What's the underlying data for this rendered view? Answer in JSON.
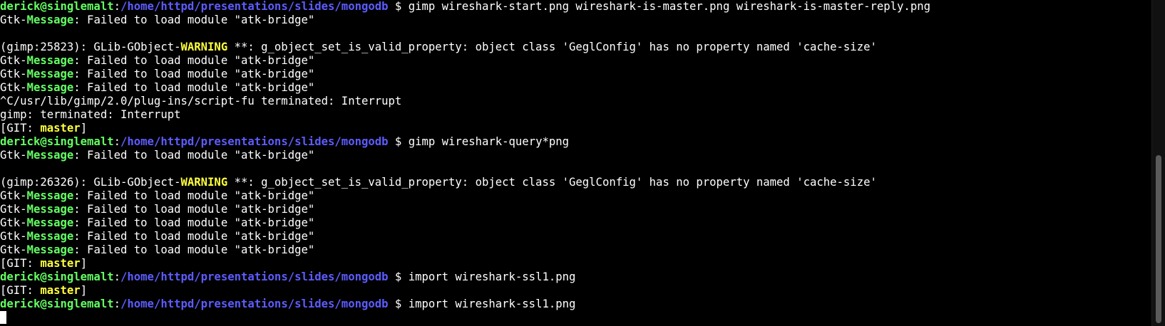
{
  "lines": [
    [
      {
        "t": "derick@singlemalt",
        "c": "green"
      },
      {
        "t": ":",
        "c": "white"
      },
      {
        "t": "/home/httpd/presentations/slides/mongodb",
        "c": "blue"
      },
      {
        "t": " $ gimp wireshark-start.png wireshark-is-master.png wireshark-is-master-reply.png",
        "c": "white"
      }
    ],
    [
      {
        "t": "Gtk-",
        "c": "white"
      },
      {
        "t": "Message",
        "c": "green"
      },
      {
        "t": ": Failed to load module \"atk-bridge\"",
        "c": "white"
      }
    ],
    [],
    [
      {
        "t": "(gimp:25823): GLib-GObject-",
        "c": "white"
      },
      {
        "t": "WARNING",
        "c": "yellow"
      },
      {
        "t": " **: g_object_set_is_valid_property: object class 'GeglConfig' has no property named 'cache-size'",
        "c": "white"
      }
    ],
    [
      {
        "t": "Gtk-",
        "c": "white"
      },
      {
        "t": "Message",
        "c": "green"
      },
      {
        "t": ": Failed to load module \"atk-bridge\"",
        "c": "white"
      }
    ],
    [
      {
        "t": "Gtk-",
        "c": "white"
      },
      {
        "t": "Message",
        "c": "green"
      },
      {
        "t": ": Failed to load module \"atk-bridge\"",
        "c": "white"
      }
    ],
    [
      {
        "t": "Gtk-",
        "c": "white"
      },
      {
        "t": "Message",
        "c": "green"
      },
      {
        "t": ": Failed to load module \"atk-bridge\"",
        "c": "white"
      }
    ],
    [
      {
        "t": "^C/usr/lib/gimp/2.0/plug-ins/script-fu terminated: Interrupt",
        "c": "white"
      }
    ],
    [
      {
        "t": "gimp: terminated: Interrupt",
        "c": "white"
      }
    ],
    [
      {
        "t": "[GIT: ",
        "c": "white"
      },
      {
        "t": "master",
        "c": "yellow"
      },
      {
        "t": "]",
        "c": "white"
      }
    ],
    [
      {
        "t": "derick@singlemalt",
        "c": "green"
      },
      {
        "t": ":",
        "c": "white"
      },
      {
        "t": "/home/httpd/presentations/slides/mongodb",
        "c": "blue"
      },
      {
        "t": " $ gimp wireshark-query*png",
        "c": "white"
      }
    ],
    [
      {
        "t": "Gtk-",
        "c": "white"
      },
      {
        "t": "Message",
        "c": "green"
      },
      {
        "t": ": Failed to load module \"atk-bridge\"",
        "c": "white"
      }
    ],
    [],
    [
      {
        "t": "(gimp:26326): GLib-GObject-",
        "c": "white"
      },
      {
        "t": "WARNING",
        "c": "yellow"
      },
      {
        "t": " **: g_object_set_is_valid_property: object class 'GeglConfig' has no property named 'cache-size'",
        "c": "white"
      }
    ],
    [
      {
        "t": "Gtk-",
        "c": "white"
      },
      {
        "t": "Message",
        "c": "green"
      },
      {
        "t": ": Failed to load module \"atk-bridge\"",
        "c": "white"
      }
    ],
    [
      {
        "t": "Gtk-",
        "c": "white"
      },
      {
        "t": "Message",
        "c": "green"
      },
      {
        "t": ": Failed to load module \"atk-bridge\"",
        "c": "white"
      }
    ],
    [
      {
        "t": "Gtk-",
        "c": "white"
      },
      {
        "t": "Message",
        "c": "green"
      },
      {
        "t": ": Failed to load module \"atk-bridge\"",
        "c": "white"
      }
    ],
    [
      {
        "t": "Gtk-",
        "c": "white"
      },
      {
        "t": "Message",
        "c": "green"
      },
      {
        "t": ": Failed to load module \"atk-bridge\"",
        "c": "white"
      }
    ],
    [
      {
        "t": "Gtk-",
        "c": "white"
      },
      {
        "t": "Message",
        "c": "green"
      },
      {
        "t": ": Failed to load module \"atk-bridge\"",
        "c": "white"
      }
    ],
    [
      {
        "t": "[GIT: ",
        "c": "white"
      },
      {
        "t": "master",
        "c": "yellow"
      },
      {
        "t": "]",
        "c": "white"
      }
    ],
    [
      {
        "t": "derick@singlemalt",
        "c": "green"
      },
      {
        "t": ":",
        "c": "white"
      },
      {
        "t": "/home/httpd/presentations/slides/mongodb",
        "c": "blue"
      },
      {
        "t": " $ import wireshark-ssl1.png",
        "c": "white"
      }
    ],
    [
      {
        "t": "[GIT: ",
        "c": "white"
      },
      {
        "t": "master",
        "c": "yellow"
      },
      {
        "t": "]",
        "c": "white"
      }
    ],
    [
      {
        "t": "derick@singlemalt",
        "c": "green"
      },
      {
        "t": ":",
        "c": "white"
      },
      {
        "t": "/home/httpd/presentations/slides/mongodb",
        "c": "blue"
      },
      {
        "t": " $ import wireshark-ssl1.png",
        "c": "white"
      }
    ]
  ],
  "colors": {
    "background": "#000000",
    "text": "#ffffff",
    "prompt_user": "#64ff64",
    "prompt_path": "#5c5cff",
    "highlight": "#ffff3c"
  }
}
